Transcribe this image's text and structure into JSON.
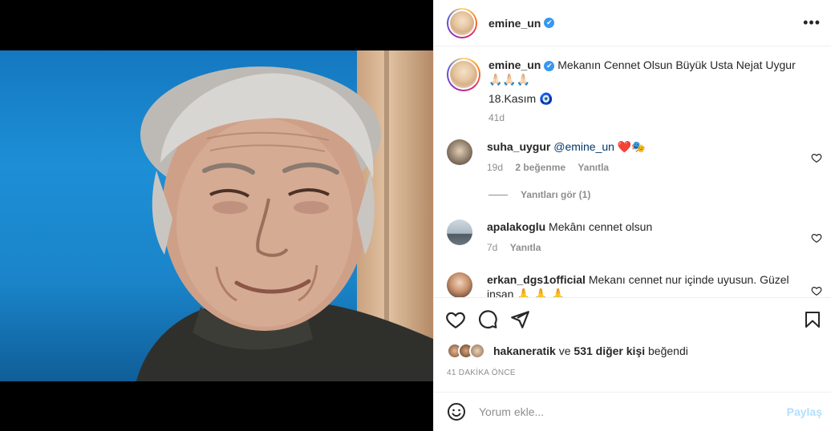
{
  "header": {
    "username": "emine_un",
    "verified_mark": "✔",
    "more_glyph": "•••"
  },
  "caption": {
    "username": "emine_un",
    "text": "Mekanın Cennet Olsun Büyük Usta Nejat Uygur 🙏🏻🙏🏻🙏🏻",
    "line2": "18.Kasım 🧿",
    "age": "41d"
  },
  "comments": [
    {
      "username": "suha_uygur",
      "mention": "@emine_un",
      "text": " ❤️🎭",
      "age": "19d",
      "likes": "2 beğenme",
      "reply": "Yanıtla"
    },
    {
      "username": "apalakoglu",
      "text": "Mekânı cennet olsun",
      "age": "7d",
      "reply": "Yanıtla"
    },
    {
      "username": "erkan_dgs1official",
      "text": "Mekanı cennet nur içinde uyusun. Güzel insan 🙏 🙏 🙏"
    }
  ],
  "view_replies": "Yanıtları gör (1)",
  "likes": {
    "liker": "hakaneratik",
    "connector": "ve",
    "others": "531 diğer kişi",
    "suffix": "beğendi"
  },
  "timestamp": "41 DAKİKA ÖNCE",
  "add_comment": {
    "placeholder": "Yorum ekle...",
    "post_label": "Paylaş"
  },
  "icons": {
    "like": "heart-icon",
    "comment": "comment-icon",
    "share": "paper-plane-icon",
    "save": "bookmark-icon",
    "emoji": "smiley-icon"
  }
}
